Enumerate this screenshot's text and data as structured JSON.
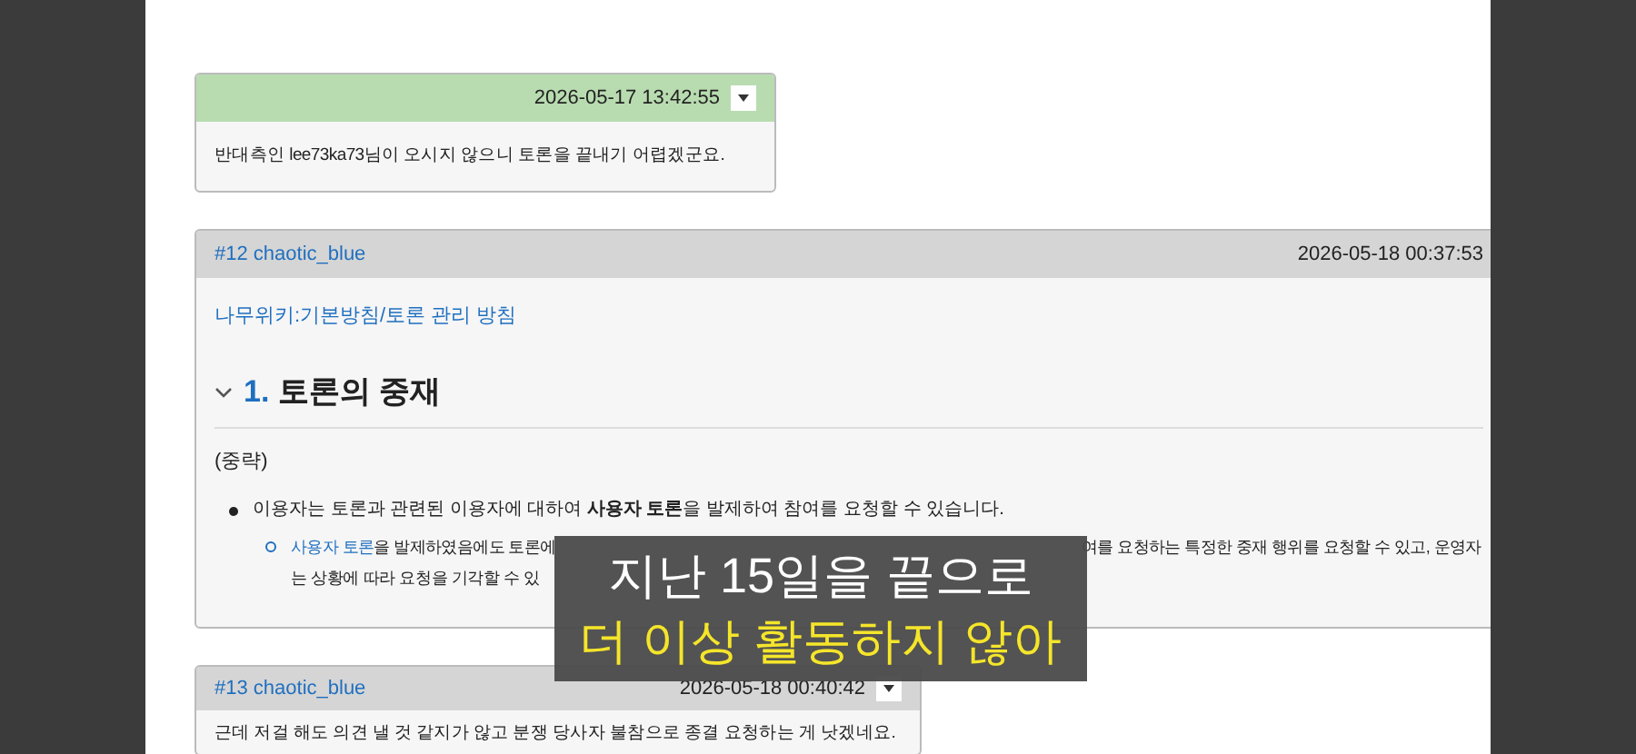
{
  "comments": [
    {
      "kind": "plain",
      "highlighted": true,
      "time": "2026-05-17 13:42:55",
      "menu": true,
      "text": "반대측인 lee73ka73님이 오시지 않으니 토론을 끝내기 어렵겠군요."
    },
    {
      "kind": "doc",
      "highlighted": false,
      "number": "#12",
      "author": "chaotic_blue",
      "time": "2026-05-18 00:37:53",
      "menu": false,
      "link": "나무위키:기본방침/토론 관리 방침",
      "heading_number": "1.",
      "heading": "토론의 중재",
      "expanded": true,
      "note": "(중략)",
      "bullet": "이용자는 토론과 관련된 이용자에 대하여 **사용자 토론**을 발제하여 참여를 요청할 수 있습니다.",
      "sub_link": "사용자 토론",
      "sub_line_1_start": "을 발제하였음에도 토론에",
      "sub_line_1_end": "여를 요청하는 특정한 중재 행위를 요청할 수 있고, 운영자",
      "sub_line_2": "는 상황에 따라 요청을 기각할 수 있"
    },
    {
      "kind": "plain",
      "highlighted": false,
      "number": "#13",
      "author": "chaotic_blue",
      "time": "2026-05-18 00:40:42",
      "menu": true,
      "text": "근데 저걸 해도 의견 낼 것 같지가 않고 분쟁 당사자 불참으로 종결 요청하는 게 낫겠네요."
    }
  ],
  "caption": {
    "line_1": "지난 15일을 끝으로",
    "line_2": "더 이상 활동하지 않아"
  }
}
